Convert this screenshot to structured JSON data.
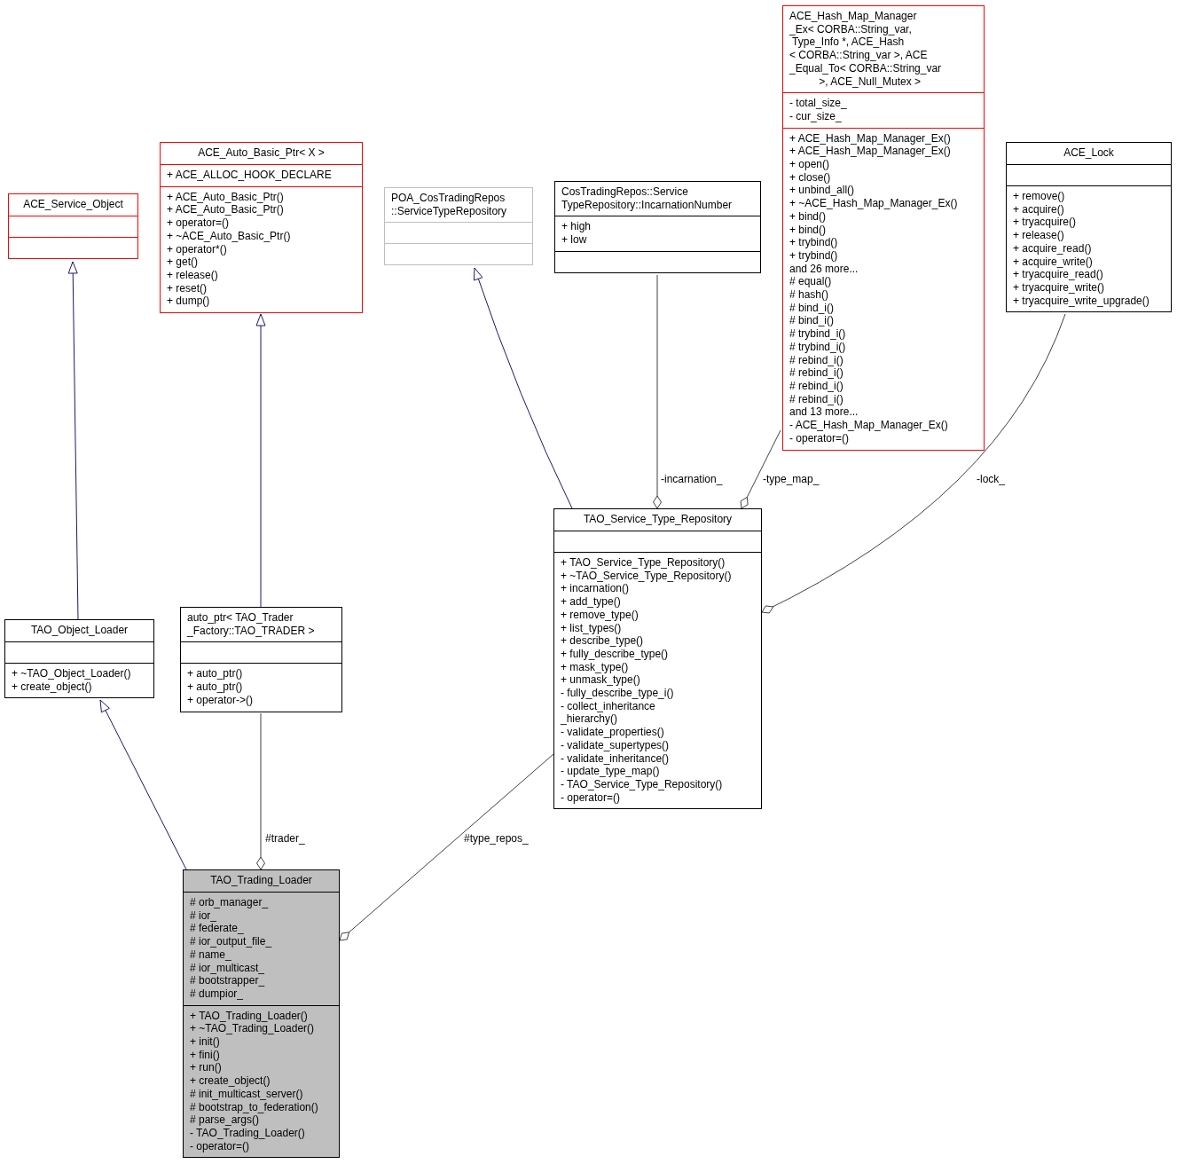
{
  "nodes": [
    {
      "title_lines": [
        "ACE_Service_Object"
      ],
      "color": "#ff0000",
      "highlighted": false
    },
    {
      "title_lines": [
        "ACE_Auto_Basic_Ptr< X >"
      ],
      "color": "#ff0000",
      "highlighted": false,
      "attributes": [
        "+ ACE_ALLOC_HOOK_DECLARE"
      ],
      "methods": [
        "+ ACE_Auto_Basic_Ptr()",
        "+ ACE_Auto_Basic_Ptr()",
        "+ operator=()",
        "+ ~ACE_Auto_Basic_Ptr()",
        "+ operator*()",
        "+ get()",
        "+ release()",
        "+ reset()",
        "+ dump()"
      ]
    },
    {
      "title_lines": [
        "POA_CosTradingRepos",
        "::ServiceTypeRepository"
      ],
      "color": "#bfbfbf",
      "highlighted": false
    },
    {
      "title_lines": [
        "CosTradingRepos::Service",
        "TypeRepository::IncarnationNumber"
      ],
      "color": "#000000",
      "highlighted": false,
      "attributes": [
        "+ high",
        "+ low"
      ]
    },
    {
      "title_lines": [
        "ACE_Hash_Map_Manager",
        "_Ex< CORBA::String_var,",
        " Type_Info *, ACE_Hash",
        "< CORBA::String_var >, ACE",
        "_Equal_To< CORBA::String_var",
        "          >, ACE_Null_Mutex >"
      ],
      "color": "#ff0000",
      "highlighted": false,
      "attributes": [
        "- total_size_",
        "- cur_size_"
      ],
      "methods": [
        "+ ACE_Hash_Map_Manager_Ex()",
        "+ ACE_Hash_Map_Manager_Ex()",
        "+ open()",
        "+ close()",
        "+ unbind_all()",
        "+ ~ACE_Hash_Map_Manager_Ex()",
        "+ bind()",
        "+ bind()",
        "+ trybind()",
        "+ trybind()",
        "and 26 more...",
        "# equal()",
        "# hash()",
        "# bind_i()",
        "# bind_i()",
        "# trybind_i()",
        "# trybind_i()",
        "# rebind_i()",
        "# rebind_i()",
        "# rebind_i()",
        "# rebind_i()",
        "and 13 more...",
        "- ACE_Hash_Map_Manager_Ex()",
        "- operator=()"
      ]
    },
    {
      "title_lines": [
        "ACE_Lock"
      ],
      "color": "#000000",
      "highlighted": false,
      "methods": [
        "+ remove()",
        "+ acquire()",
        "+ tryacquire()",
        "+ release()",
        "+ acquire_read()",
        "+ acquire_write()",
        "+ tryacquire_read()",
        "+ tryacquire_write()",
        "+ tryacquire_write_upgrade()"
      ]
    },
    {
      "title_lines": [
        "TAO_Object_Loader"
      ],
      "color": "#000000",
      "highlighted": false,
      "methods": [
        "+ ~TAO_Object_Loader()",
        "+ create_object()"
      ]
    },
    {
      "title_lines": [
        "auto_ptr< TAO_Trader",
        "_Factory::TAO_TRADER >"
      ],
      "color": "#000000",
      "highlighted": false,
      "methods": [
        "+ auto_ptr()",
        "+ auto_ptr()",
        "+ operator->()"
      ]
    },
    {
      "title_lines": [
        "TAO_Service_Type_Repository"
      ],
      "color": "#000000",
      "highlighted": false,
      "methods": [
        "+ TAO_Service_Type_Repository()",
        "+ ~TAO_Service_Type_Repository()",
        "+ incarnation()",
        "+ add_type()",
        "+ remove_type()",
        "+ list_types()",
        "+ describe_type()",
        "+ fully_describe_type()",
        "+ mask_type()",
        "+ unmask_type()",
        "- fully_describe_type_i()",
        "- collect_inheritance",
        "_hierarchy()",
        "- validate_properties()",
        "- validate_supertypes()",
        "- validate_inheritance()",
        "- update_type_map()",
        "- TAO_Service_Type_Repository()",
        "- operator=()"
      ]
    },
    {
      "title_lines": [
        "TAO_Trading_Loader"
      ],
      "color": "#000000",
      "highlighted": true,
      "attributes": [
        "# orb_manager_",
        "# ior_",
        "# federate_",
        "# ior_output_file_",
        "# name_",
        "# ior_multicast_",
        "# bootstrapper_",
        "# dumpior_"
      ],
      "methods": [
        "+ TAO_Trading_Loader()",
        "+ ~TAO_Trading_Loader()",
        "+ init()",
        "+ fini()",
        "+ run()",
        "+ create_object()",
        "# init_multicast_server()",
        "# bootstrap_to_federation()",
        "# parse_args()",
        "- TAO_Trading_Loader()",
        "- operator=()"
      ]
    }
  ],
  "edges": [
    {
      "kind": "inheritance"
    },
    {
      "kind": "inheritance"
    },
    {
      "kind": "inheritance"
    },
    {
      "kind": "inheritance"
    },
    {
      "kind": "usage",
      "label": "-incarnation_"
    },
    {
      "kind": "usage",
      "label": "-type_map_"
    },
    {
      "kind": "usage",
      "label": "-lock_"
    },
    {
      "kind": "usage",
      "label": "#trader_"
    },
    {
      "kind": "usage",
      "label": "#type_repos_"
    }
  ]
}
